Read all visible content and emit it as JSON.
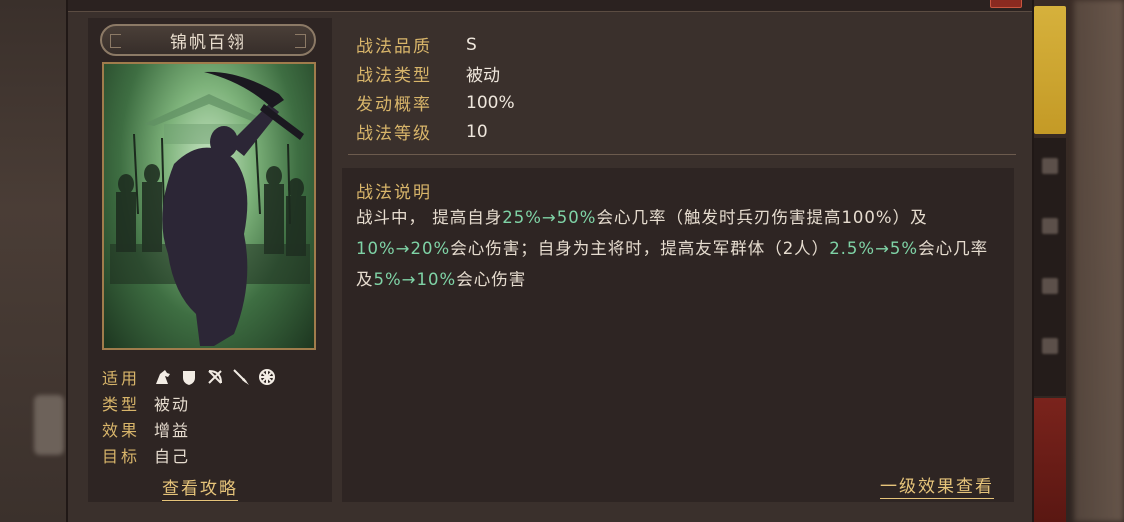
{
  "skill": {
    "name": "锦帆百翎",
    "stats": [
      {
        "key": "战法品质",
        "value": "S"
      },
      {
        "key": "战法类型",
        "value": "被动"
      },
      {
        "key": "发动概率",
        "value": "100%"
      },
      {
        "key": "战法等级",
        "value": "10"
      }
    ],
    "meta": {
      "applicable_key": "适用",
      "type_key": "类型",
      "type_val": "被动",
      "effect_key": "效果",
      "effect_val": "增益",
      "target_key": "目标",
      "target_val": "自己",
      "troop_icons": [
        "cavalry-icon",
        "shield-icon",
        "bow-icon",
        "spear-icon",
        "vehicle-icon"
      ]
    },
    "guide_link": "查看攻略",
    "desc_title": "战法说明",
    "desc_segments": [
      {
        "t": "战斗中， 提高自身",
        "hl": false
      },
      {
        "t": "25%→50%",
        "hl": true
      },
      {
        "t": "会心几率（触发时兵刃伤害提高100%）及",
        "hl": false
      },
      {
        "t": "10%→20%",
        "hl": true
      },
      {
        "t": "会心伤害；自身为主将时，提高友军群体（2人）",
        "hl": false
      },
      {
        "t": "2.5%→5%",
        "hl": true
      },
      {
        "t": "会心几率及",
        "hl": false
      },
      {
        "t": "5%→10%",
        "hl": true
      },
      {
        "t": "会心伤害",
        "hl": false
      }
    ],
    "level_link": "一级效果查看"
  },
  "colors": {
    "accent_gold": "#d8b56a",
    "highlight_green": "#7fd3a6",
    "panel_bg": "#3a302c"
  }
}
